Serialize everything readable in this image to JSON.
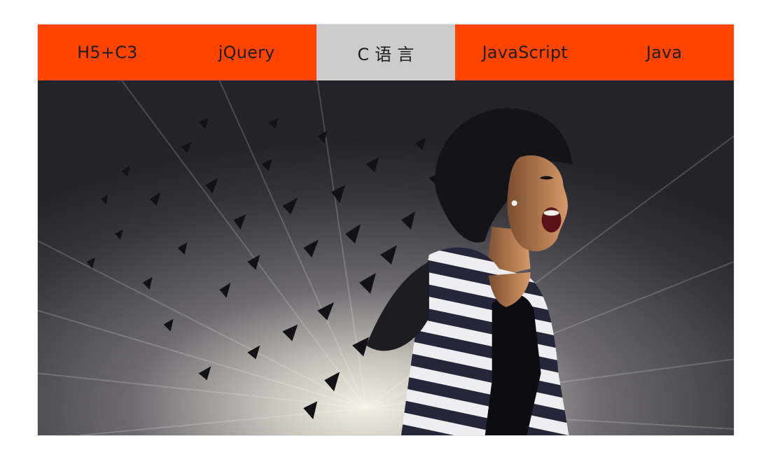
{
  "tabs": [
    {
      "label": "H5+C3",
      "active": false
    },
    {
      "label": "jQuery",
      "active": false
    },
    {
      "label": "C 语 言",
      "active": true
    },
    {
      "label": "JavaScript",
      "active": false
    },
    {
      "label": "Java",
      "active": false
    }
  ],
  "colors": {
    "tab_background": "#ff4400",
    "tab_active_background": "#cccccc",
    "tab_text": "#1e1e1e"
  },
  "panel": {
    "image_subject": "shattering-woman-screaming-photo"
  }
}
